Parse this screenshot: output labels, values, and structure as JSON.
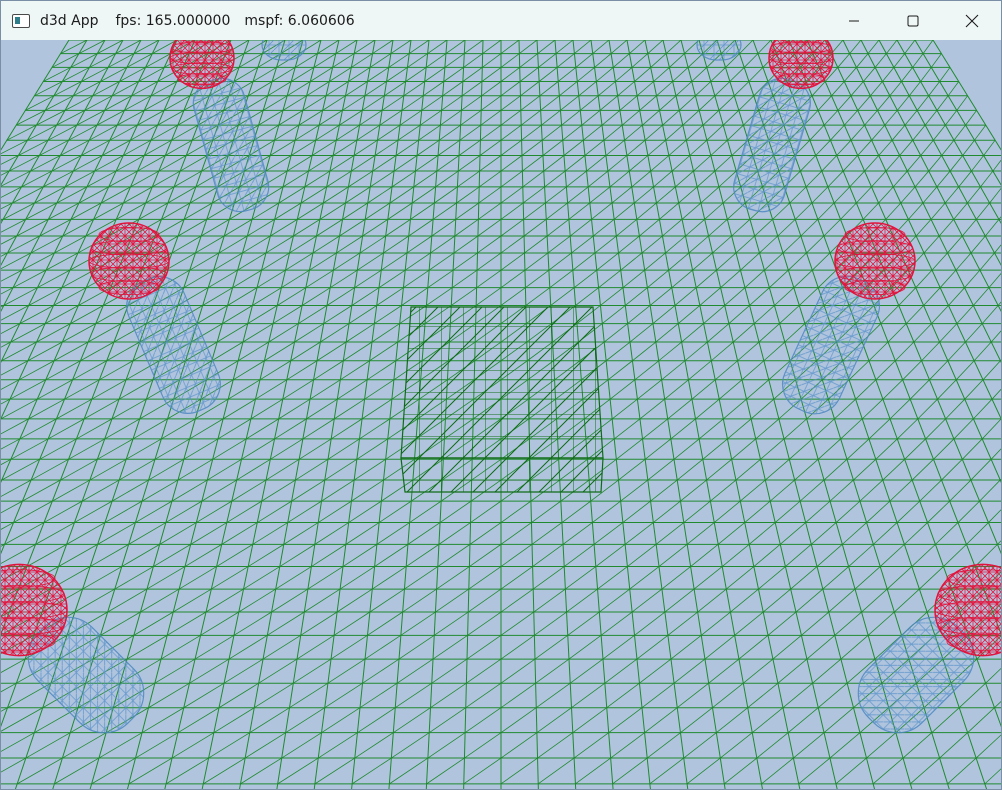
{
  "window": {
    "app_title": "d3d App",
    "fps_text": "fps: 165.000000",
    "mspf_text": "mspf: 6.060606",
    "icon": "app-window-icon",
    "buttons": [
      {
        "name": "minimize-button",
        "icon": "minimize-icon"
      },
      {
        "name": "maximize-button",
        "icon": "maximize-icon"
      },
      {
        "name": "close-button",
        "icon": "close-icon"
      }
    ]
  },
  "scene": {
    "background_color": "#b0c4de",
    "grid_color": "#1f8a2e",
    "box_color": "#0f6b16",
    "cylinder_color": "#4f88c0",
    "sphere_color": "#e0143c",
    "render_mode": "wireframe"
  }
}
